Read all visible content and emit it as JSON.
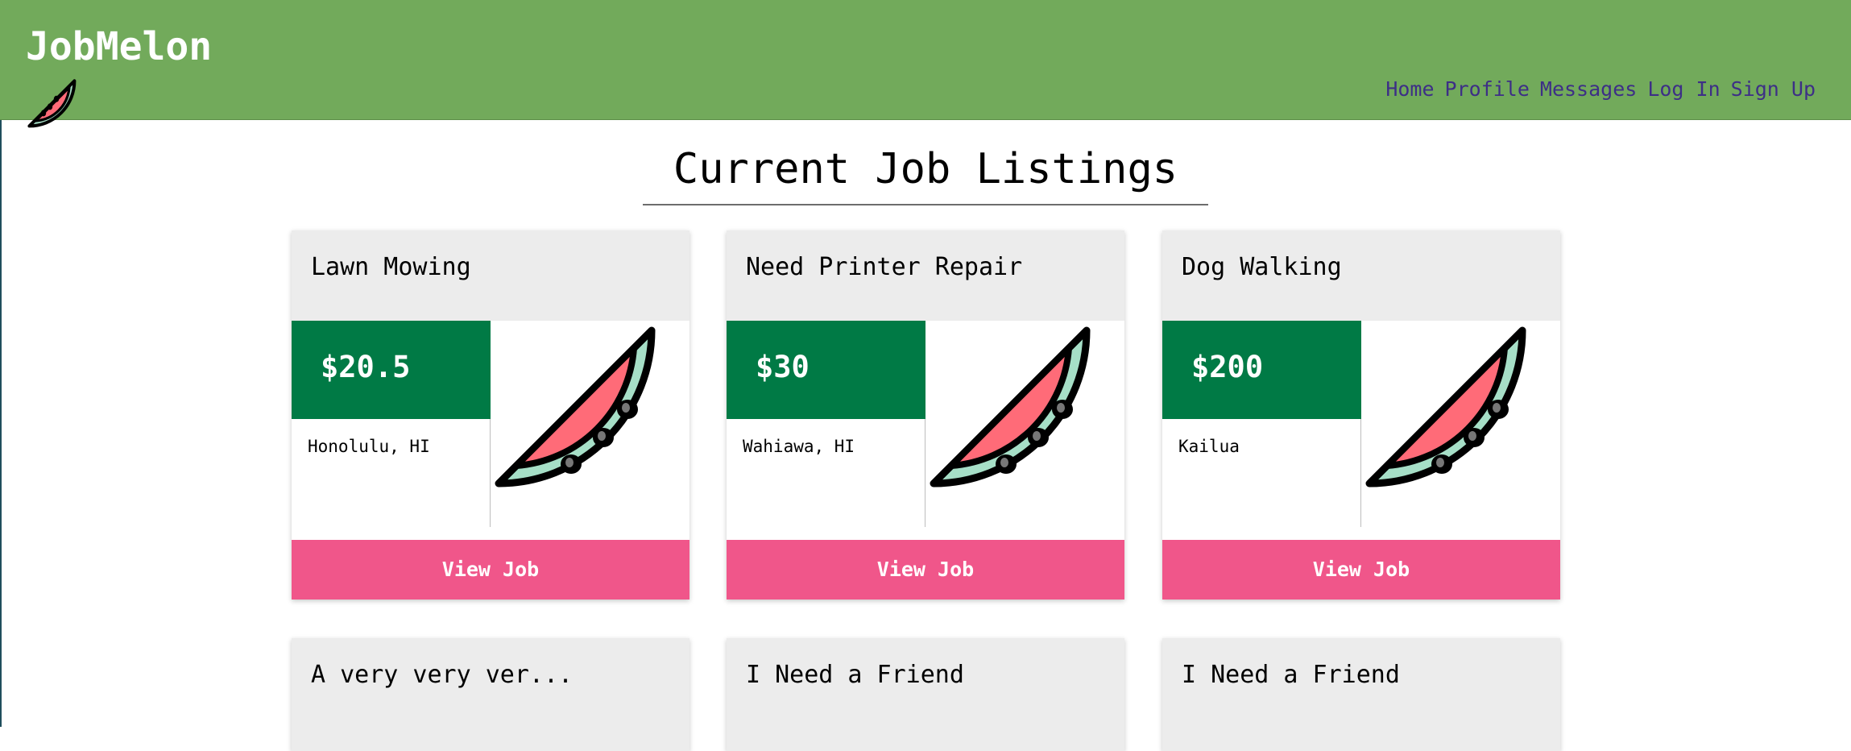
{
  "app": {
    "brand": "JobMelon"
  },
  "nav": {
    "items": [
      "Home",
      "Profile",
      "Messages",
      "Log In",
      "Sign Up"
    ]
  },
  "page": {
    "title": "Current Job Listings"
  },
  "cards": [
    {
      "title": "Lawn Mowing",
      "price": "$20.5",
      "location": "Honolulu, HI",
      "button": "View Job"
    },
    {
      "title": "Need Printer Repair",
      "price": "$30",
      "location": "Wahiawa, HI",
      "button": "View Job"
    },
    {
      "title": "Dog Walking",
      "price": "$200",
      "location": "Kailua",
      "button": "View Job"
    }
  ],
  "cards_row2": [
    {
      "title": "A very very ver..."
    },
    {
      "title": "I Need a Friend"
    },
    {
      "title": "I Need a Friend"
    }
  ],
  "colors": {
    "header": "#72aa5b",
    "price_box": "#007a45",
    "button": "#f0568a",
    "nav_link": "#3d2f86",
    "card_header": "#ececec",
    "watermelon_flesh": "#ff6b78",
    "watermelon_rind": "#a6dfc7"
  },
  "icons": {
    "logo": "watermelon-icon",
    "card_image": "watermelon-icon"
  }
}
